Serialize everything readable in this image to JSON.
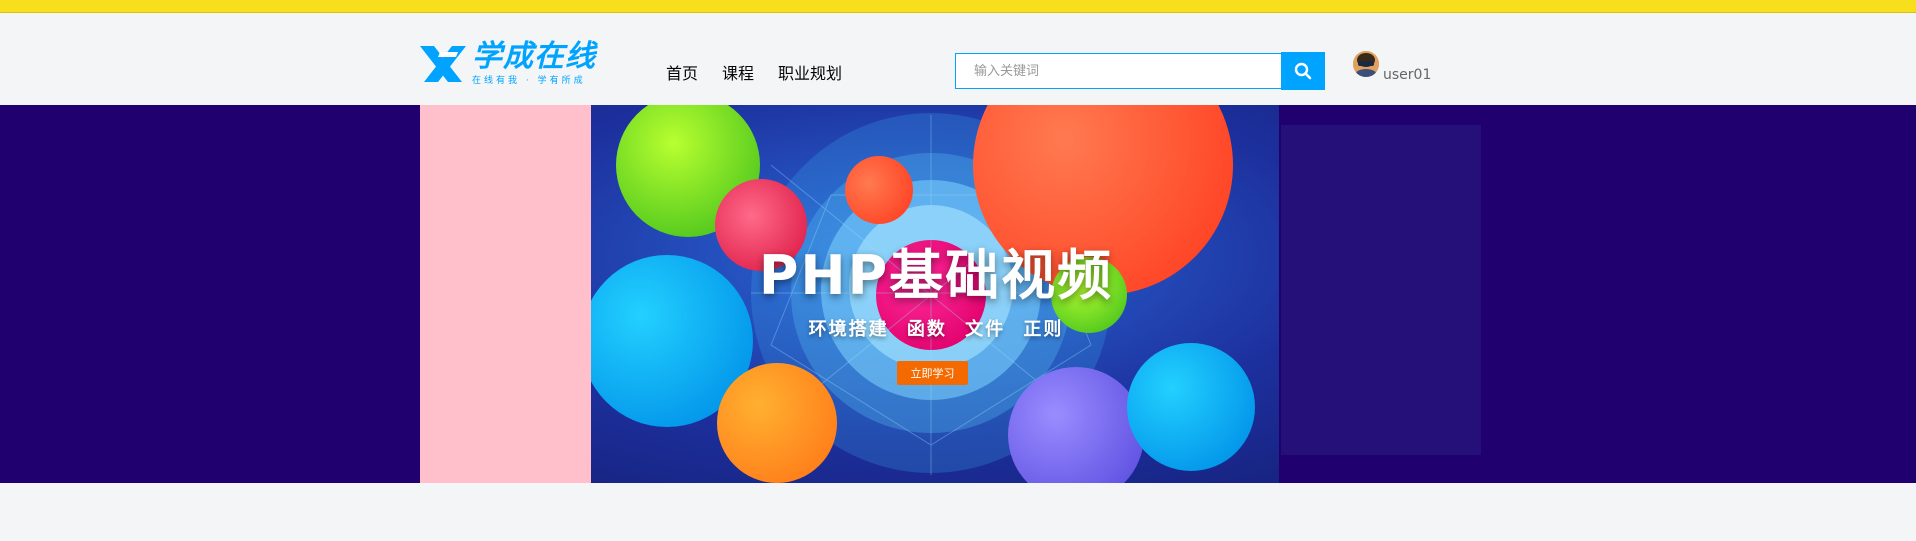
{
  "header": {
    "logo": {
      "title": "学成在线",
      "slogan": "在线有我 · 学有所成"
    },
    "nav": [
      {
        "label": "首页"
      },
      {
        "label": "课程"
      },
      {
        "label": "职业规划"
      }
    ],
    "search": {
      "placeholder": "输入关键词",
      "value": ""
    },
    "user": {
      "name": "user01"
    }
  },
  "banner": {
    "title": "PHP基础视频",
    "subtitle": "环境搭建  函数 文件  正则",
    "button_label": "立即学习"
  },
  "colors": {
    "brand": "#00a4ff",
    "banner_bg": "#1f006e",
    "banner_side": "#ffc0cb",
    "cta": "#f56a00",
    "topstrip": "#f7df1e"
  },
  "icons": {
    "search": "search-icon",
    "logo": "logo-mark-icon",
    "avatar": "user-avatar"
  }
}
